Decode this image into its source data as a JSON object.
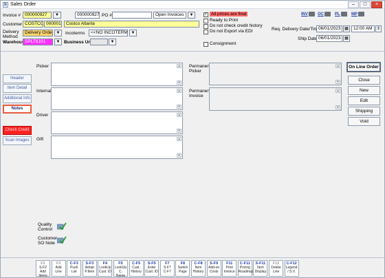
{
  "window": {
    "title": "Sales Order",
    "app_letter": "b"
  },
  "header": {
    "invoice_label": "Invoice #",
    "invoice_value": "000000927",
    "invoice_copy": "000000927",
    "po_label": "PO #",
    "po_value": "",
    "status_value": "Open Invoices",
    "customer_label": "Customer",
    "customer_code": "COSTCO",
    "customer_num": "000001",
    "customer_name": "Costco Atlanta",
    "delivery_label_1": "Delivery",
    "delivery_label_2": "Method",
    "delivery_value": "Delivery Order",
    "incoterms_label": "Incoterms",
    "incoterms_value": "<<NO INCOTERMS>>",
    "warehouse_label": "Warehouse",
    "warehouse_value": "SPLT6101",
    "business_unit_label": "Business Unit",
    "business_unit_value": ""
  },
  "checkboxes": [
    {
      "label": "All prices are final",
      "checked": true
    },
    {
      "label": "Ready to Print",
      "checked": false
    },
    {
      "label": "Do not check credit history",
      "checked": false
    },
    {
      "label": "Do not Export via EDI",
      "checked": false
    },
    {
      "label": "Consignment",
      "checked": false
    }
  ],
  "toolbar": {
    "inv": "INV",
    "oc": "OC",
    "pl": "P̲",
    "pl_text": "PL",
    "mp": "MP"
  },
  "dates": {
    "req_label": "Req. Delivery Date/Time",
    "req_value": "06/01/2023",
    "time_value": "12:00 AM",
    "ship_label": "Ship Date",
    "ship_value": "06/01/2023"
  },
  "side_nav": [
    "Header",
    "Item Detail",
    "Additional Info",
    "Notes",
    "Check Credit",
    "Scan Images"
  ],
  "notes": {
    "picker": "Picker",
    "internal": "Internal",
    "driver": "Driver",
    "gift": "Gift",
    "permanent_picker_1": "Permanent",
    "permanent_picker_2": "Picker",
    "permanent_invoice_1": "Permanent",
    "permanent_invoice_2": "Invoice"
  },
  "right_buttons": [
    "On Line Order",
    "Close",
    "New",
    "Edit",
    "Shipping",
    "Void"
  ],
  "quality": {
    "qc_1": "Quality",
    "qc_2": "Control",
    "cso_1": "Customer",
    "cso_2": "SO Note"
  },
  "fkeys": [
    {
      "key": "F2",
      "sub": "S-F2",
      "desc": "Add Items",
      "disabled": true
    },
    {
      "key": "F3",
      "sub": "",
      "desc": "Add Line",
      "disabled": true
    },
    {
      "key": "C-F3",
      "sub": "Push",
      "desc": "List",
      "disabled": false
    },
    {
      "key": "S-F3",
      "sub": "Adopt",
      "desc": "P.Item",
      "disabled": false
    },
    {
      "key": "F4",
      "sub": "LookUp",
      "desc": "Cust. ID",
      "disabled": false
    },
    {
      "key": "F5",
      "sub": "LookUp",
      "desc": "C. Name",
      "disabled": false
    },
    {
      "key": "C-F5",
      "sub": "Cust.",
      "desc": "History",
      "disabled": false
    },
    {
      "key": "S-F5",
      "sub": "Enter",
      "desc": "Cust. ID",
      "disabled": false
    },
    {
      "key": "F7",
      "sub": "S-F7",
      "desc": "C-F7",
      "disabled": false
    },
    {
      "key": "F8",
      "sub": "Switch",
      "desc": "Page",
      "disabled": false
    },
    {
      "key": "C-F8",
      "sub": "Item",
      "desc": "History",
      "disabled": false
    },
    {
      "key": "S-F9",
      "sub": "Add-on",
      "desc": "Costs",
      "disabled": false
    },
    {
      "key": "F11",
      "sub": "Print",
      "desc": "Invoice",
      "disabled": false
    },
    {
      "key": "C-F11",
      "sub": "Pricing",
      "desc": "Roadmap",
      "disabled": false
    },
    {
      "key": "S-F11",
      "sub": "Item",
      "desc": "Display",
      "disabled": false
    },
    {
      "key": "F12",
      "sub": "Delete",
      "desc": "Line",
      "disabled": true
    },
    {
      "key": "C-F12",
      "sub": "Legend",
      "desc": "/ S.V.",
      "disabled": false
    }
  ]
}
